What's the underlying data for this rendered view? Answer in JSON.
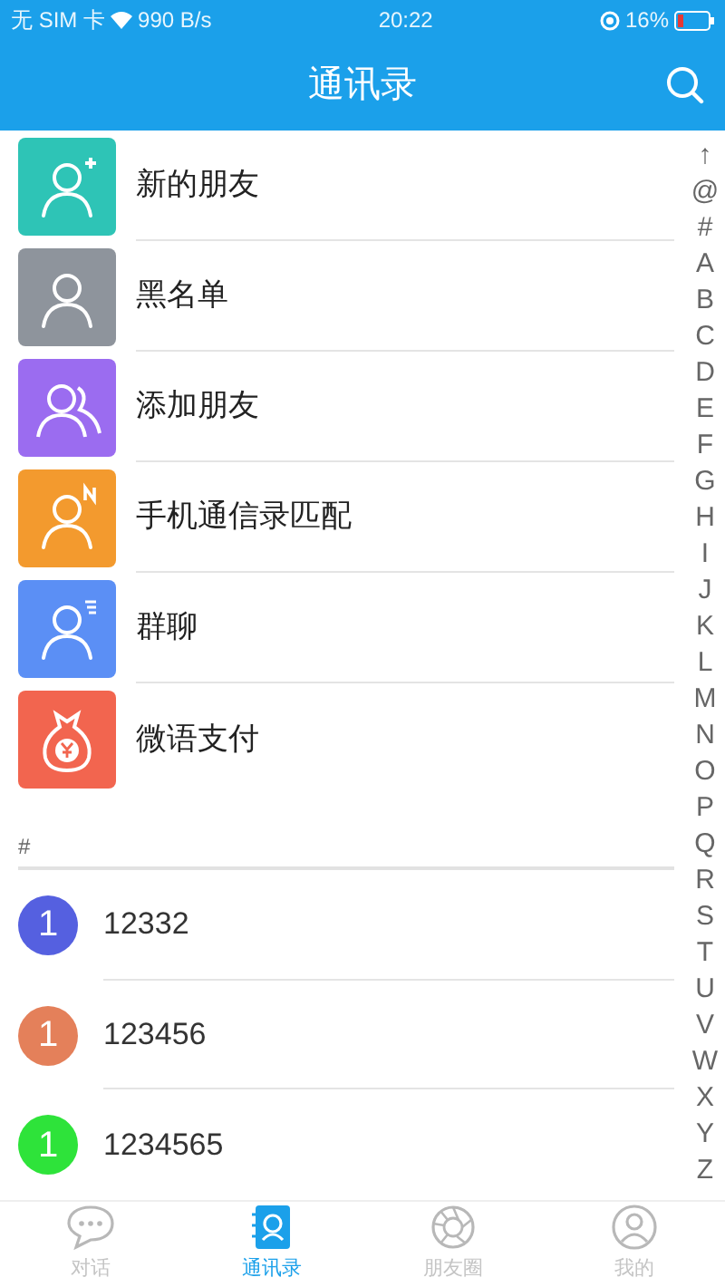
{
  "status_bar": {
    "carrier": "无 SIM 卡",
    "speed": "990 B/s",
    "time": "20:22",
    "battery": "16%"
  },
  "header": {
    "title": "通讯录"
  },
  "menu": [
    {
      "label": "新的朋友",
      "kind": "new-friend",
      "color": "#2ec4b6"
    },
    {
      "label": "黑名单",
      "kind": "blacklist",
      "color": "#8e949c"
    },
    {
      "label": "添加朋友",
      "kind": "add-friend",
      "color": "#9b6cf0"
    },
    {
      "label": "手机通信录匹配",
      "kind": "phone-match",
      "color": "#f39a2e"
    },
    {
      "label": "群聊",
      "kind": "group-chat",
      "color": "#5b8ff5"
    },
    {
      "label": "微语支付",
      "kind": "payment",
      "color": "#f2654f"
    }
  ],
  "section": "#",
  "contacts": [
    {
      "initial": "1",
      "name": "12332",
      "color": "#5560e0"
    },
    {
      "initial": "1",
      "name": "123456",
      "color": "#e4805a"
    },
    {
      "initial": "1",
      "name": "1234565",
      "color": "#2ee33a"
    }
  ],
  "index": [
    "↑",
    "@",
    "#",
    "A",
    "B",
    "C",
    "D",
    "E",
    "F",
    "G",
    "H",
    "I",
    "J",
    "K",
    "L",
    "M",
    "N",
    "O",
    "P",
    "Q",
    "R",
    "S",
    "T",
    "U",
    "V",
    "W",
    "X",
    "Y",
    "Z"
  ],
  "tabs": [
    {
      "label": "对话",
      "kind": "chat",
      "selected": false
    },
    {
      "label": "通讯录",
      "kind": "contacts",
      "selected": true
    },
    {
      "label": "朋友圈",
      "kind": "moments",
      "selected": false
    },
    {
      "label": "我的",
      "kind": "me",
      "selected": false
    }
  ]
}
